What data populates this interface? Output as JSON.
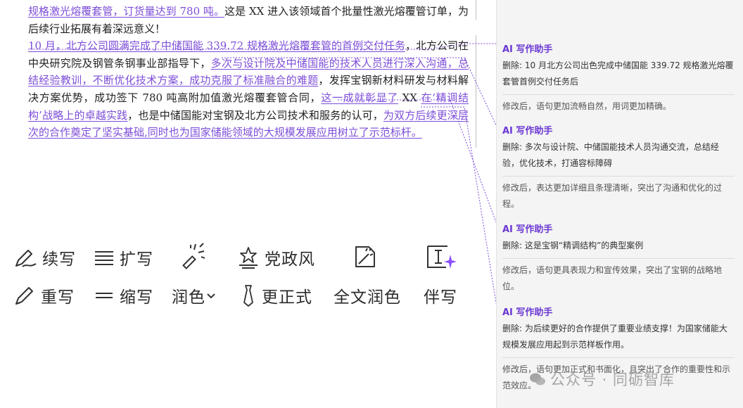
{
  "document": {
    "p1_rev_a": "规格激光熔覆套管，订货量达到 780 吨。",
    "p1_text_a": "这是 XX 进入该领域首个批量性激光熔覆管订单，为后续行业拓展有着深远意义！",
    "p2_rev_a": "10 月，北方公司圆满完成了中储国能 339.72 规格激光熔覆套管的首例交付任务",
    "p2_text_a": "，北方公司在中央研究院及钢管条钢事业部指导下，",
    "p2_rev_b": "多次与设计院及中储国能的技术人员进行深入沟通，总结经验教训，不断优化技术方案，成功克服了标准融合的难题",
    "p2_text_b": "，发挥宝钢新材料研发与材料解决方案优势，成功签下 780 吨高附加值激光熔覆套管合同，",
    "p2_rev_c": "这一成就彰显了",
    "p2_text_c": " XX ",
    "p2_rev_d": "在‘精调结构’战略上的卓越实践",
    "p2_text_d": "，也是中储国能对宝钢及北方公司技术和服务的认可，",
    "p2_rev_e": "为双方后续更深层次的合作奠定了坚实基础,同时也为国家储能领域的大规模发展应用树立了示范标杆。"
  },
  "toolbar": {
    "continue": "续写",
    "expand": "扩写",
    "party_style": "党政风",
    "rewrite": "重写",
    "shorten": "缩写",
    "polish": "润色",
    "formal": "更正式",
    "full_polish": "全文润色",
    "companion": "伴写"
  },
  "comments": [
    {
      "author": "AI 写作助手",
      "body": "删除: 10 月北方公司出色完成中储国能 339.72 规格激光熔覆套管首例交付任务后",
      "reply": "修改后，语句更加流畅自然，用词更加精确。"
    },
    {
      "author": "AI 写作助手",
      "body": "删除: 多次与设计院、中储国能技术人员沟通交流，总结经验，优化技术，打通容标障碍",
      "reply": "修改后，表达更加详细且条理清晰，突出了沟通和优化的过程。"
    },
    {
      "author": "AI 写作助手",
      "body": "删除: 这是宝钢“精调结构”的典型案例",
      "reply": "修改后，语句更具表现力和宣传效果，突出了宝钢的战略地位。"
    },
    {
      "author": "AI 写作助手",
      "body": "删除: 为后续更好的合作提供了重要业绩支撑！为国家储能大规模发展应用起到示范样板作用。",
      "reply": "修改后，语句更加正式和书面化，且突出了合作的重要性和示范效应。"
    }
  ],
  "watermark": "公众号 · 同砺智库",
  "colors": {
    "revision": "#7c4dd8",
    "comment_author": "#6b38d4",
    "sidebar_bg": "#f4f4f4"
  }
}
